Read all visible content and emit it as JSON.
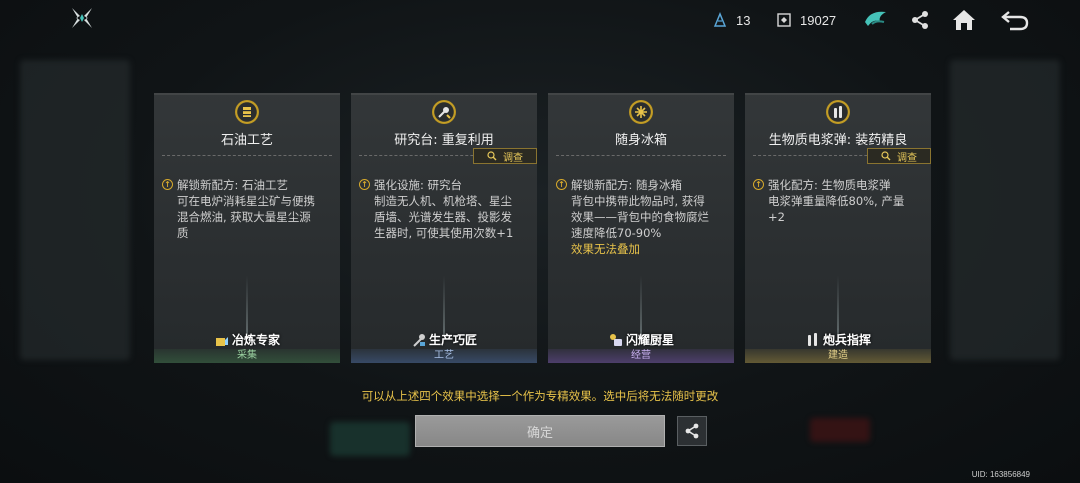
{
  "header": {
    "resource_1": {
      "icon": "crystal-icon",
      "value": "13"
    },
    "resource_2": {
      "icon": "currency-icon",
      "value": "19027"
    }
  },
  "cards": [
    {
      "icon": "oil-barrel-icon",
      "title": "石油工艺",
      "has_inspect": false,
      "line1": "解锁新配方: 石油工艺",
      "desc": [
        "可在电炉消耗星尘矿与便携",
        "混合燃油, 获取大量星尘源",
        "质"
      ],
      "highlight": "",
      "badge": "冶炼专家",
      "badge_icon": "smelting-icon",
      "tag": "采集",
      "tag_color": "#5a9a60"
    },
    {
      "icon": "drill-icon",
      "title": "研究台: 重复利用",
      "has_inspect": true,
      "line1": "强化设施: 研究台",
      "desc": [
        "制造无人机、机枪塔、星尘",
        "盾墙、光谱发生器、投影发",
        "生器时, 可使其使用次数+1"
      ],
      "highlight": "",
      "badge": "生产巧匠",
      "badge_icon": "craftsman-icon",
      "tag": "工艺",
      "tag_color": "#5a7bb0"
    },
    {
      "icon": "snowflake-icon",
      "title": "随身冰箱",
      "has_inspect": false,
      "line1": "解锁新配方: 随身冰箱",
      "desc": [
        "背包中携带此物品时, 获得",
        "效果——背包中的食物腐烂",
        "速度降低70-90%"
      ],
      "highlight": "效果无法叠加",
      "badge": "闪耀厨星",
      "badge_icon": "chef-icon",
      "tag": "经营",
      "tag_color": "#7a5ab0"
    },
    {
      "icon": "shells-icon",
      "title": "生物质电浆弹: 装药精良",
      "has_inspect": true,
      "line1": "强化配方: 生物质电浆弹",
      "desc": [
        "电浆弹重量降低80%, 产量",
        "+2"
      ],
      "highlight": "",
      "badge": "炮兵指挥",
      "badge_icon": "artillery-icon",
      "tag": "建造",
      "tag_color": "#b09a40"
    }
  ],
  "inspect_label": "调查",
  "notice": "可以从上述四个效果中选择一个作为专精效果。选中后将无法随时更改",
  "confirm_label": "确定",
  "uid": "UID: 163856849"
}
